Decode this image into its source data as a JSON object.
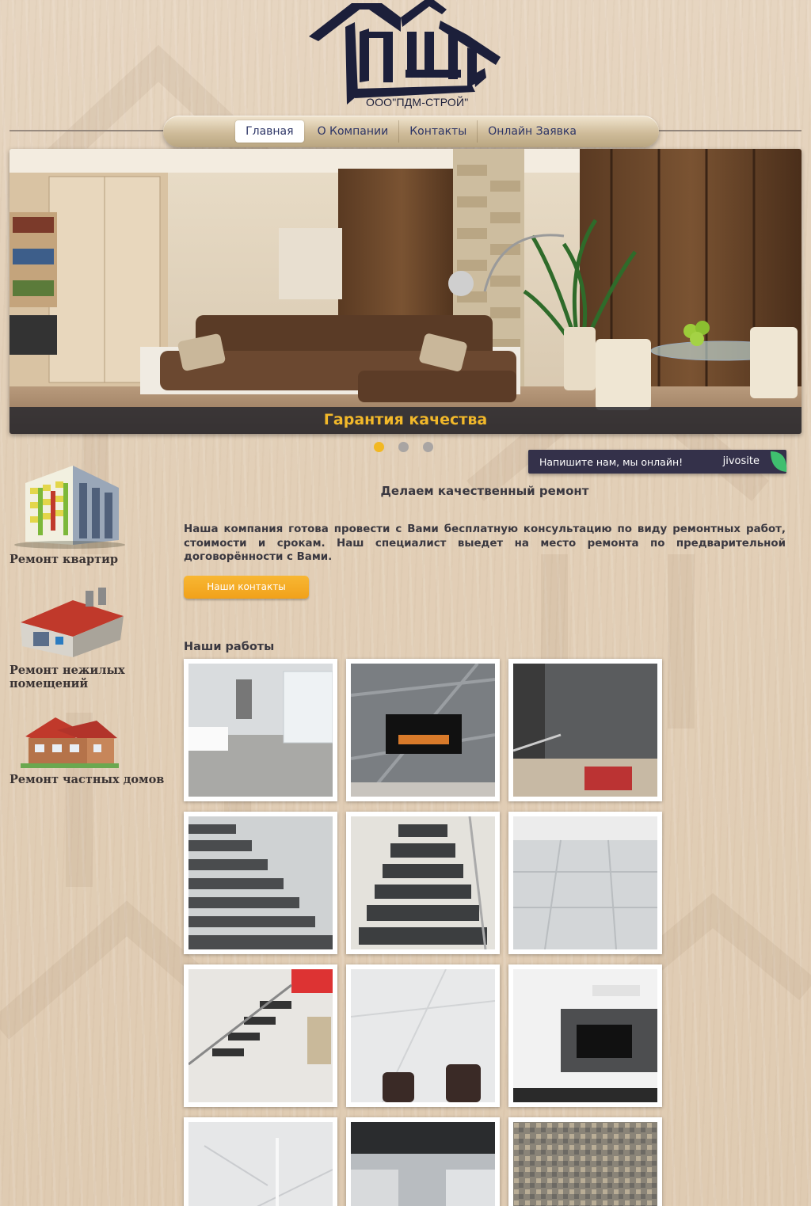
{
  "logo": {
    "company": "ООО\"ПДМ-СТРОЙ\""
  },
  "nav": {
    "items": [
      {
        "label": "Главная",
        "active": true
      },
      {
        "label": "О Компании",
        "active": false
      },
      {
        "label": "Контакты",
        "active": false
      },
      {
        "label": "Онлайн Заявка",
        "active": false
      }
    ]
  },
  "slider": {
    "caption": "Гарантия качества",
    "dots": [
      {
        "active": true
      },
      {
        "active": false
      },
      {
        "active": false
      }
    ]
  },
  "chat": {
    "text": "Напишите нам, мы онлайн!",
    "brand": "jivosite"
  },
  "sidebar": {
    "items": [
      {
        "label": "Ремонт квартир",
        "icon": "apartment-building-icon"
      },
      {
        "label": "Ремонт нежилых помещений",
        "icon": "warehouse-icon"
      },
      {
        "label": "Ремонт частных домов",
        "icon": "house-icon"
      }
    ]
  },
  "main": {
    "title": "Делаем качественный ремонт",
    "text": "Наша компания готова провести с Вами бесплатную консультацию по виду ремонтных работ, стоимости и срокам. Наш специалист выедет на место ремонта по предварительной договорённости с Вами.",
    "contacts_button": "Наши контакты",
    "works_title": "Наши работы"
  },
  "colors": {
    "accent": "#f2b822",
    "nav_text": "#2c3466",
    "logo": "#1c1f3a",
    "chat_bg": "#34314a"
  }
}
